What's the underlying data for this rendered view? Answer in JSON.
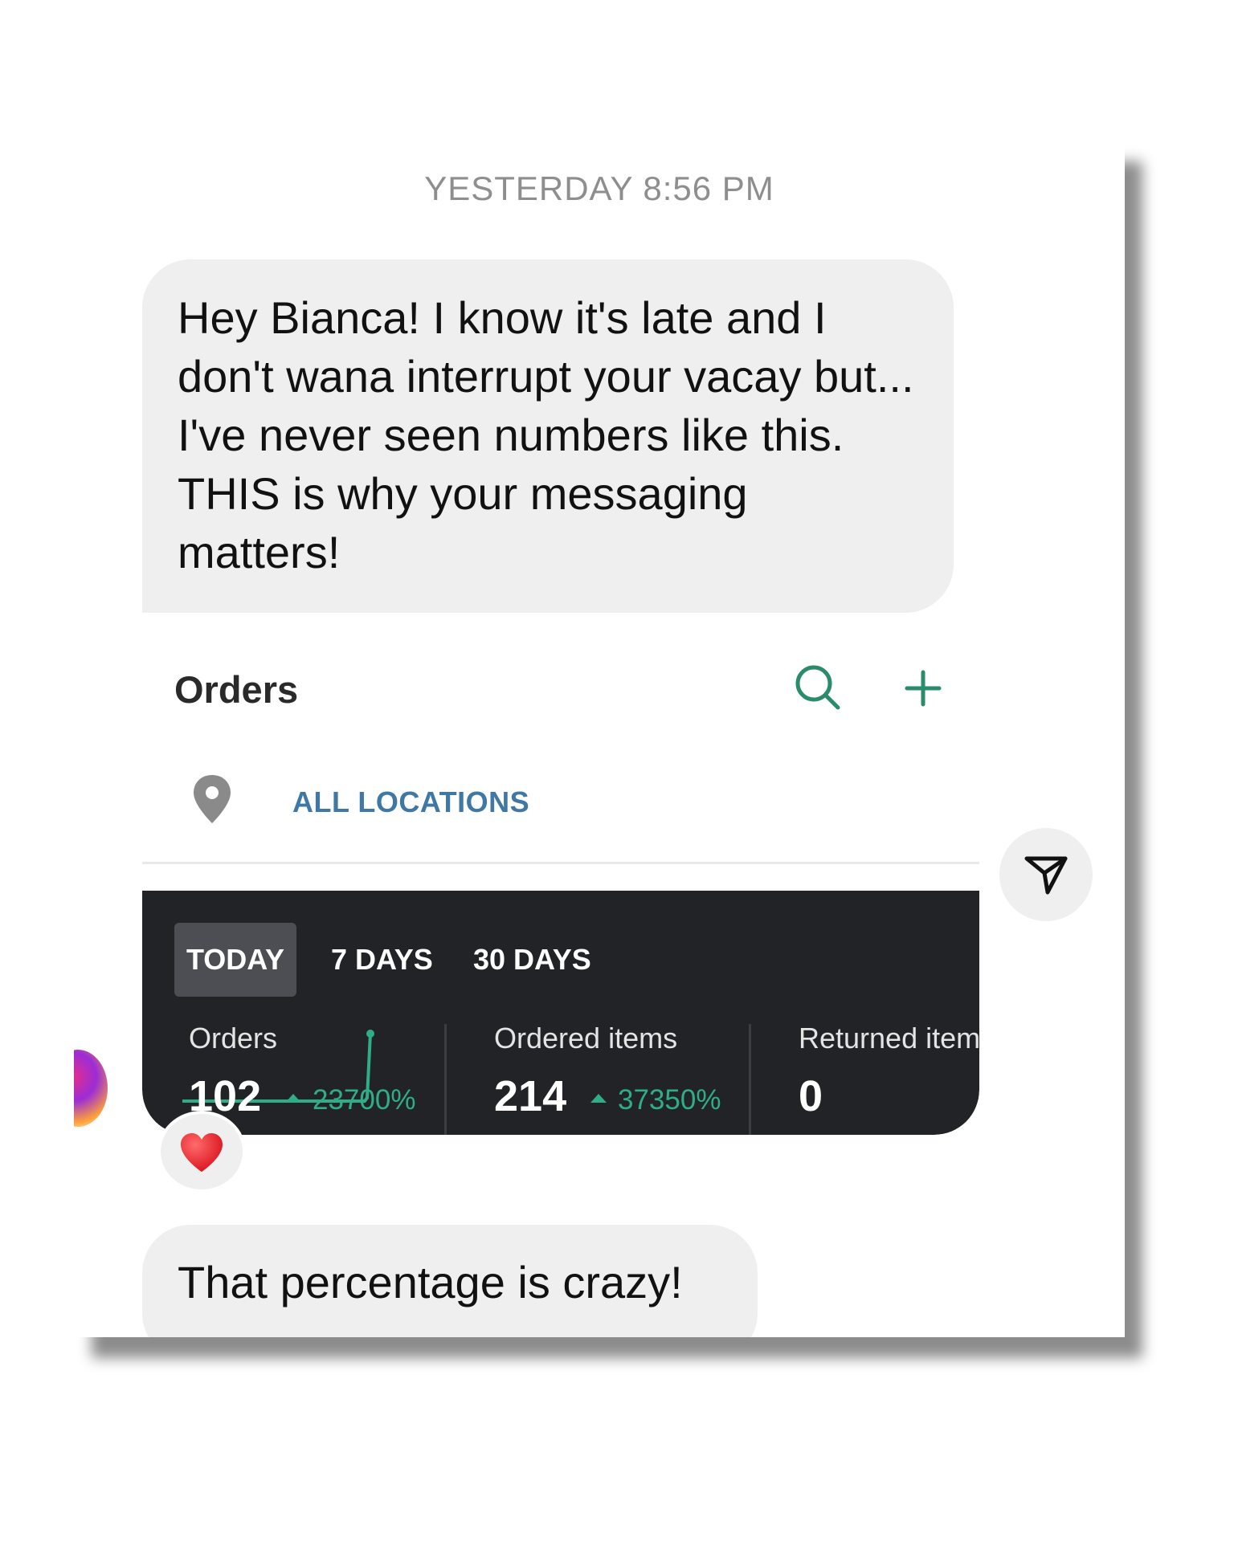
{
  "thread": {
    "timestamp": "YESTERDAY 8:56 PM",
    "message_1": "Hey Bianca! I know it's late and I don't wana interrupt your vacay but... I've never seen numbers like this. THIS is why your messaging matters!",
    "message_2": "That percentage is crazy!",
    "reaction_emoji": "heart-emoji"
  },
  "attachment": {
    "title": "Orders",
    "location_label": "ALL LOCATIONS",
    "tabs": [
      {
        "label": "TODAY",
        "selected": true
      },
      {
        "label": "7 DAYS",
        "selected": false
      },
      {
        "label": "30 DAYS",
        "selected": false
      }
    ],
    "stats": [
      {
        "label": "Orders",
        "value": "102",
        "change": "23700%"
      },
      {
        "label": "Ordered items",
        "value": "214",
        "change": "37350%"
      },
      {
        "label": "Returned item",
        "value": "0"
      }
    ]
  },
  "icons": [
    "search-icon",
    "plus-icon",
    "location-pin-icon",
    "send-icon",
    "heart-emoji",
    "avatar"
  ],
  "colors": {
    "accent_green": "#2fae86",
    "location_blue": "#3f78a5",
    "bubble_gray": "#efefef",
    "dark_panel": "#222326"
  }
}
